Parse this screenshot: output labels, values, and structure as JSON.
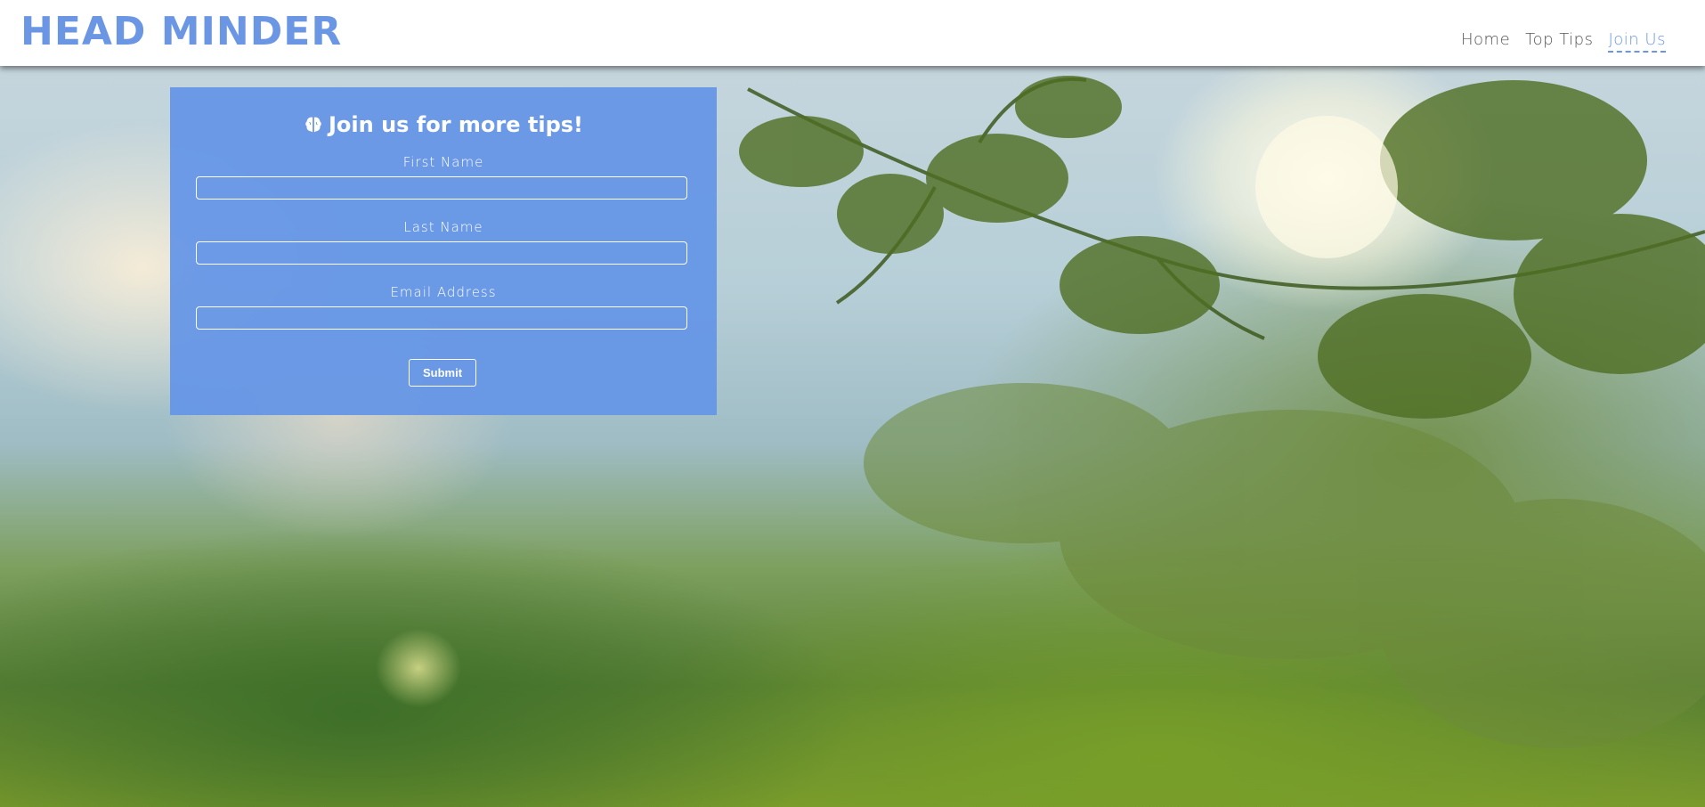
{
  "header": {
    "brand": "HEAD MINDER",
    "nav": [
      {
        "label": "Home"
      },
      {
        "label": "Top Tips"
      },
      {
        "label": "Join Us"
      }
    ]
  },
  "form": {
    "title": "Join us for more tips!",
    "title_icon": "brain-icon",
    "fields": [
      {
        "label": "First Name",
        "value": ""
      },
      {
        "label": "Last Name",
        "value": ""
      },
      {
        "label": "Email Address",
        "value": ""
      }
    ],
    "submit_label": "Submit"
  },
  "colors": {
    "accent": "#6b96e3",
    "card": "#6494e6"
  }
}
